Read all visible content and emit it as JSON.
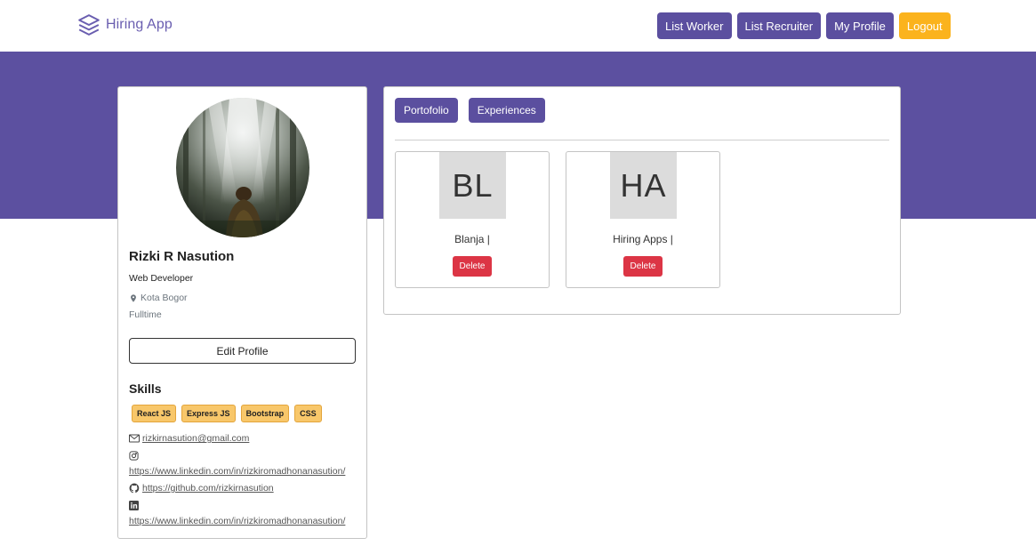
{
  "navbar": {
    "brand": "Hiring App",
    "buttons": [
      "List Worker",
      "List Recruiter",
      "My Profile"
    ],
    "logout": "Logout"
  },
  "profile": {
    "name": "Rizki R Nasution",
    "job": "Web Developer",
    "location": "Kota Bogor",
    "status": "Fulltime",
    "edit_label": "Edit Profile",
    "skills_title": "Skills",
    "skills": [
      "React JS",
      "Express JS",
      "Bootstrap",
      "CSS"
    ],
    "email": "rizkirnasution@gmail.com",
    "instagram": "https://www.linkedin.com/in/rizkiromadhonanasution/",
    "github": "https://github.com/rizkirnasution",
    "linkedin": "https://www.linkedin.com/in/rizkiromadhonanasution/"
  },
  "tabs": [
    "Portofolio",
    "Experiences"
  ],
  "portfolio": [
    {
      "initials": "BL",
      "title": "Blanja |",
      "delete_label": "Delete"
    },
    {
      "initials": "HA",
      "title": "Hiring Apps |",
      "delete_label": "Delete"
    }
  ],
  "colors": {
    "primary": "#5b4f9f",
    "banner": "#5c50a0",
    "accent": "#fbb31d",
    "danger": "#dc3545",
    "skill": "#f8c76a"
  }
}
